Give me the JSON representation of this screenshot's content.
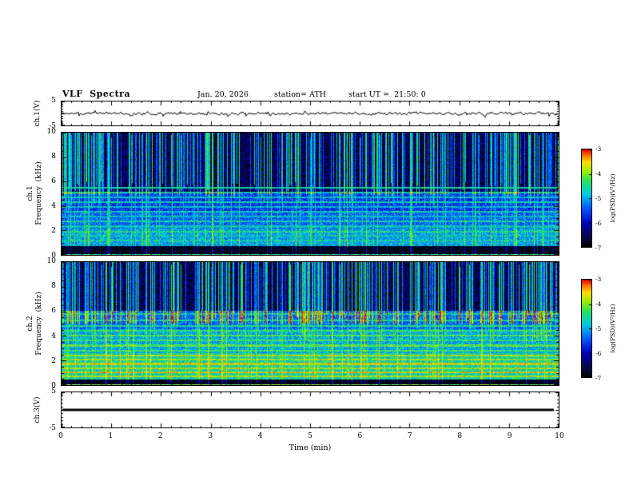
{
  "title": "VLF  Spectra",
  "header": {
    "date": "Jan. 20, 2026",
    "station": "station= ATH",
    "start_ut": "start UT =  21:50: 0"
  },
  "axes": {
    "time": {
      "label": "Time  (min)",
      "min": 0,
      "max": 10,
      "ticks": [
        0,
        1,
        2,
        3,
        4,
        5,
        6,
        7,
        8,
        9,
        10
      ],
      "minor_step": 0.2
    },
    "wave1": {
      "label": "ch.1(V)",
      "min": -5,
      "max": 5,
      "ticks": [
        5,
        -5
      ]
    },
    "spec1": {
      "label_line1": "ch.1",
      "label_line2": "Frequency  (kHz)",
      "min": 0,
      "max": 10,
      "ticks": [
        10,
        8,
        6,
        4,
        2,
        0
      ]
    },
    "spec2": {
      "label_line1": "ch.2",
      "label_line2": "Frequency  (kHz)",
      "min": 0,
      "max": 10,
      "ticks": [
        10,
        8,
        6,
        4,
        2,
        0
      ]
    },
    "wave3": {
      "label": "ch.3(V)",
      "min": -5,
      "max": 5,
      "ticks": [
        5,
        -5
      ]
    }
  },
  "colorbar": {
    "label": "log(PSD)(V²/Hz)",
    "min": -7,
    "max": -3,
    "ticks": [
      -3,
      -4,
      -5,
      -6,
      -7
    ]
  },
  "colormap_stops": [
    {
      "v": 0.0,
      "color": "#000000"
    },
    {
      "v": 0.1,
      "color": "#080846"
    },
    {
      "v": 0.25,
      "color": "#0000be"
    },
    {
      "v": 0.4,
      "color": "#005aff"
    },
    {
      "v": 0.55,
      "color": "#00cde1"
    },
    {
      "v": 0.68,
      "color": "#28e15a"
    },
    {
      "v": 0.78,
      "color": "#a0eb00"
    },
    {
      "v": 0.87,
      "color": "#ffe100"
    },
    {
      "v": 0.94,
      "color": "#ff7800"
    },
    {
      "v": 1.0,
      "color": "#e10000"
    }
  ],
  "chart_data": [
    {
      "type": "line",
      "name": "ch1_time_series",
      "axis_label": "ch.1(V)",
      "xlim": [
        0,
        10
      ],
      "ylim": [
        -5,
        5
      ],
      "description": "Broadband noise waveform centred on 0 V, peak-to-peak about 1.5 V with occasional impulsive spikes",
      "gen": {
        "seed": 11,
        "sigma_v": 0.42,
        "ar": 0.55,
        "spike_prob": 0.03,
        "spike_v": 1.4
      }
    },
    {
      "type": "heatmap",
      "name": "ch1_spectrogram",
      "axis_label_line1": "ch.1",
      "axis_label_line2": "Frequency  (kHz)",
      "xlim": [
        0,
        10
      ],
      "ylim": [
        0,
        10
      ],
      "zlim": [
        -7,
        -3
      ],
      "zlabel": "log(PSD)(V²/Hz)",
      "regions": [
        {
          "f0": 0.0,
          "f1": 0.12,
          "psd": -4.6
        },
        {
          "f0": 0.12,
          "f1": 0.72,
          "psd": -6.95
        },
        {
          "f0": 0.72,
          "f1": 2.2,
          "psd": -5.0
        },
        {
          "f0": 2.2,
          "f1": 3.6,
          "psd": -5.35
        },
        {
          "f0": 3.6,
          "f1": 5.2,
          "psd": -5.6
        },
        {
          "f0": 5.2,
          "f1": 10.1,
          "psd": -6.55
        }
      ],
      "lines": [
        {
          "f": 1.2,
          "psd": -4.65
        },
        {
          "f": 1.6,
          "psd": -4.75
        },
        {
          "f": 1.95,
          "psd": -4.55
        },
        {
          "f": 2.35,
          "psd": -4.75
        },
        {
          "f": 2.75,
          "psd": -4.65
        },
        {
          "f": 3.15,
          "psd": -4.85
        },
        {
          "f": 3.55,
          "psd": -4.75
        },
        {
          "f": 3.95,
          "psd": -4.85
        },
        {
          "f": 4.35,
          "psd": -4.65
        },
        {
          "f": 4.75,
          "psd": -4.85
        },
        {
          "f": 5.15,
          "psd": -4.75
        },
        {
          "f": 5.55,
          "psd": -4.65
        }
      ],
      "sferics": {
        "density": 0.45,
        "min_boost": 0.9,
        "max_boost": 2.4,
        "full_height_fraction": 0.35
      },
      "gen": {
        "seed": 42,
        "noise": 0.55
      }
    },
    {
      "type": "heatmap",
      "name": "ch2_spectrogram",
      "axis_label_line1": "ch.2",
      "axis_label_line2": "Frequency  (kHz)",
      "xlim": [
        0,
        10
      ],
      "ylim": [
        0,
        10
      ],
      "zlim": [
        -7,
        -3
      ],
      "zlabel": "log(PSD)(V²/Hz)",
      "regions": [
        {
          "f0": 0.0,
          "f1": 0.1,
          "psd": -4.2
        },
        {
          "f0": 0.1,
          "f1": 0.5,
          "psd": -6.95
        },
        {
          "f0": 0.5,
          "f1": 2.6,
          "psd": -4.6
        },
        {
          "f0": 2.6,
          "f1": 4.6,
          "psd": -4.95
        },
        {
          "f0": 4.6,
          "f1": 6.1,
          "psd": -5.35
        },
        {
          "f0": 6.1,
          "f1": 10.1,
          "psd": -6.55
        }
      ],
      "lines": [
        {
          "f": 0.75,
          "psd": -3.8
        },
        {
          "f": 1.05,
          "psd": -3.6
        },
        {
          "f": 1.4,
          "psd": -3.8
        },
        {
          "f": 1.75,
          "psd": -3.7
        },
        {
          "f": 2.1,
          "psd": -3.9
        },
        {
          "f": 2.45,
          "psd": -3.8
        },
        {
          "f": 2.85,
          "psd": -4.3
        },
        {
          "f": 3.25,
          "psd": -4.2
        },
        {
          "f": 3.65,
          "psd": -4.35
        },
        {
          "f": 4.05,
          "psd": -4.25
        },
        {
          "f": 4.45,
          "psd": -4.4
        },
        {
          "f": 4.85,
          "psd": -4.5
        },
        {
          "f": 5.3,
          "psd": -4.6
        },
        {
          "f": 5.8,
          "psd": -4.7
        }
      ],
      "sferics": {
        "density": 0.45,
        "min_boost": 0.9,
        "max_boost": 2.4,
        "full_height_fraction": 0.3
      },
      "gen": {
        "seed": 77,
        "noise": 0.55
      }
    },
    {
      "type": "line",
      "name": "ch3_time_series",
      "axis_label": "ch.3(V)",
      "xlim": [
        0,
        10
      ],
      "ylim": [
        -5,
        5
      ],
      "description": "Flat heavy black trace at 0 V (no signal)",
      "gen": {
        "flat": 0,
        "linewidth": 3
      }
    }
  ]
}
